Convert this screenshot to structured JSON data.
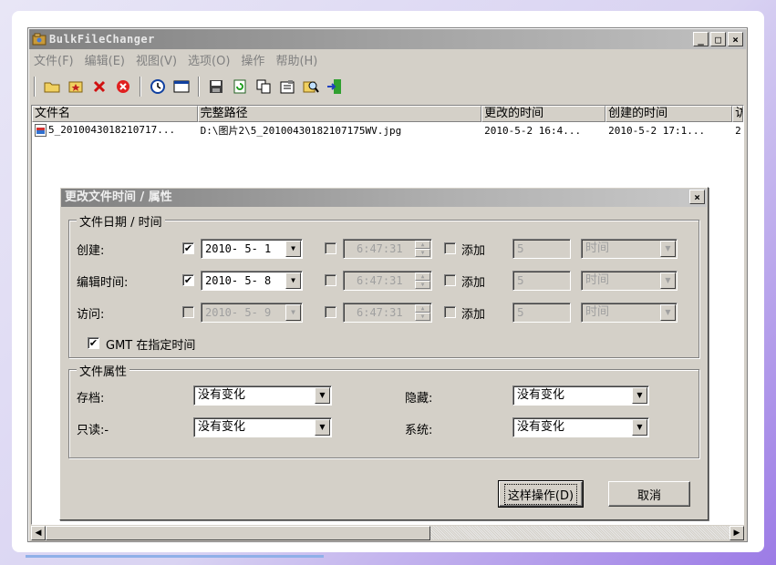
{
  "app": {
    "title": "BulkFileChanger"
  },
  "window_buttons": {
    "minimize": "_",
    "maximize": "□",
    "close": "×"
  },
  "menu": [
    "文件(F)",
    "编辑(E)",
    "视图(V)",
    "选项(O)",
    "操作",
    "帮助(H)"
  ],
  "toolbar": [
    "open-folder-icon",
    "add-files-icon",
    "remove-icon",
    "stop-icon",
    "clock-icon",
    "window-icon",
    "save-icon",
    "refresh-icon",
    "copy-icon",
    "properties-icon",
    "find-icon",
    "exit-icon"
  ],
  "list": {
    "columns": [
      "文件名",
      "完整路径",
      "更改的时间",
      "创建的时间",
      "访"
    ],
    "rows": [
      {
        "name": "5_2010043018210717...",
        "path": "D:\\图片2\\5_20100430182107175WV.jpg",
        "modified": "2010-5-2 16:4...",
        "created": "2010-5-2 17:1...",
        "accessed": "2"
      }
    ]
  },
  "dialog": {
    "title": "更改文件时间 / 属性",
    "close": "×",
    "date_group": {
      "legend": "文件日期 / 时间",
      "rows": [
        {
          "label": "创建:",
          "date_checked": true,
          "date": "2010- 5- 1",
          "date_enabled": true,
          "time_checked": false,
          "time": "6:47:31",
          "add_label": "添加",
          "add_checked": false,
          "add_value": "5",
          "unit": "时间"
        },
        {
          "label": "编辑时间:",
          "date_checked": true,
          "date": "2010- 5- 8",
          "date_enabled": true,
          "time_checked": false,
          "time": "6:47:31",
          "add_label": "添加",
          "add_checked": false,
          "add_value": "5",
          "unit": "时间"
        },
        {
          "label": "访问:",
          "date_checked": false,
          "date": "2010- 5- 9",
          "date_enabled": false,
          "time_checked": false,
          "time": "6:47:31",
          "add_label": "添加",
          "add_checked": false,
          "add_value": "5",
          "unit": "时间"
        }
      ],
      "gmt_checked": true,
      "gmt_label": "GMT 在指定时间"
    },
    "attr_group": {
      "legend": "文件属性",
      "archive_label": "存档:",
      "archive_value": "没有变化",
      "hidden_label": "隐藏:",
      "hidden_value": "没有变化",
      "readonly_label": "只读:-",
      "readonly_value": "没有变化",
      "system_label": "系统:",
      "system_value": "没有变化"
    },
    "ok_label": "这样操作(D)",
    "cancel_label": "取消"
  },
  "progress_fraction": 0.41
}
